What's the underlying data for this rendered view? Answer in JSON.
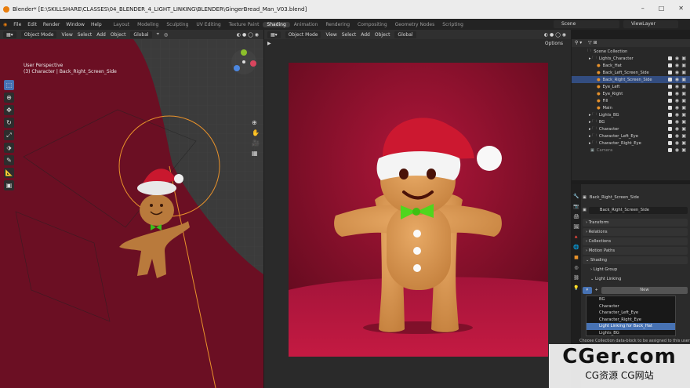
{
  "window": {
    "title": "Blender* [E:\\SKILLSHARE\\CLASSES\\04_BLENDER_4_LIGHT_LINKING\\BLENDER\\GingerBread_Man_V03.blend]",
    "controls": [
      "–",
      "□",
      "✕"
    ]
  },
  "menu": {
    "items": [
      "File",
      "Edit",
      "Render",
      "Window",
      "Help"
    ],
    "workspaces": [
      "Layout",
      "Modeling",
      "Sculpting",
      "UV Editing",
      "Texture Paint",
      "Shading",
      "Animation",
      "Rendering",
      "Compositing",
      "Geometry Nodes",
      "Scripting"
    ],
    "active_workspace": "Shading",
    "scene": "Scene",
    "view_layer": "ViewLayer"
  },
  "left_viewport": {
    "mode": "Object Mode",
    "menus": [
      "View",
      "Select",
      "Add",
      "Object"
    ],
    "orientation": "Global",
    "info_line1": "User Perspective",
    "info_line2": "(3) Character | Back_Right_Screen_Side"
  },
  "right_viewport": {
    "mode": "Object Mode",
    "menus": [
      "View",
      "Select",
      "Add",
      "Object"
    ],
    "orientation": "Global",
    "options": "Options",
    "colors": {
      "backdrop_top": "#7a0f24",
      "backdrop_bottom": "#b01638",
      "floor": "#c41a42"
    }
  },
  "outliner": {
    "title": "Scene Collection",
    "rows": [
      {
        "label": "Lights_Character",
        "indent": 1,
        "type": "collection"
      },
      {
        "label": "Back_Hat",
        "indent": 2,
        "type": "light"
      },
      {
        "label": "Back_Left_Screen_Side",
        "indent": 2,
        "type": "light"
      },
      {
        "label": "Back_Right_Screen_Side",
        "indent": 2,
        "type": "light",
        "selected": true
      },
      {
        "label": "Eye_Left",
        "indent": 2,
        "type": "light"
      },
      {
        "label": "Eye_Right",
        "indent": 2,
        "type": "light"
      },
      {
        "label": "Fill",
        "indent": 2,
        "type": "light"
      },
      {
        "label": "Main",
        "indent": 2,
        "type": "light"
      },
      {
        "label": "Lights_BG",
        "indent": 1,
        "type": "collection"
      },
      {
        "label": "BG",
        "indent": 1,
        "type": "collection"
      },
      {
        "label": "Character",
        "indent": 1,
        "type": "collection"
      },
      {
        "label": "Character_Left_Eye",
        "indent": 1,
        "type": "collection"
      },
      {
        "label": "Character_Right_Eye",
        "indent": 1,
        "type": "collection"
      },
      {
        "label": "Camera",
        "indent": 1,
        "type": "camera"
      }
    ]
  },
  "properties": {
    "object_name": "Back_Right_Screen_Side",
    "object_field": "Back_Right_Screen_Side",
    "panels": [
      "Transform",
      "Relations",
      "Collections",
      "Motion Paths",
      "Shading",
      "Light Group",
      "Light Linking"
    ],
    "new_button": "New",
    "dropdown_items": [
      "BG",
      "Character",
      "Character_Left_Eye",
      "Character_Right_Eye",
      "Light Linking for Back_Hat",
      "Lights_BG"
    ],
    "dropdown_highlighted": "Light Linking for Back_Hat",
    "status": "Choose Collection data-block to be assigned to this user"
  },
  "watermark": {
    "line1": "CGer.com",
    "line2": "CG资源 CG网站"
  }
}
